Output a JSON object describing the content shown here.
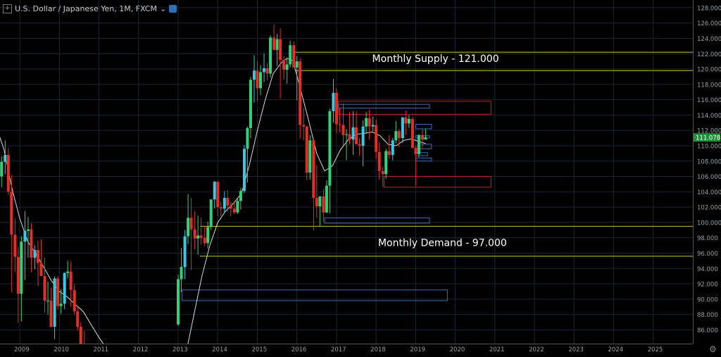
{
  "header": {
    "symbol": "U.S. Dollar / Japanese Yen, 1M, FXCM",
    "expand_icon": "plus-square-icon",
    "visibility_icon": "eye-icon"
  },
  "settings_icon": "gear-icon",
  "chart_data": {
    "type": "candlestick",
    "timeframe": "1M",
    "x_ticks": [
      "2009",
      "2010",
      "2011",
      "2012",
      "2013",
      "2014",
      "2015",
      "2016",
      "2017",
      "2018",
      "2019",
      "2020",
      "2021",
      "2022",
      "2023",
      "2024",
      "2025"
    ],
    "y_ticks": [
      86,
      88,
      90,
      92,
      94,
      96,
      98,
      100,
      102,
      104,
      106,
      108,
      110,
      112,
      114,
      116,
      118,
      120,
      122,
      124,
      126,
      128
    ],
    "y_tick_labels": [
      "86.000",
      "88.000",
      "90.000",
      "92.000",
      "94.000",
      "96.000",
      "98.000",
      "100.000",
      "102.000",
      "104.000",
      "106.000",
      "108.000",
      "110.000",
      "112.000",
      "114.000",
      "116.000",
      "118.000",
      "120.000",
      "122.000",
      "124.000",
      "126.000",
      "128.000"
    ],
    "ylim": [
      84.2,
      129.0
    ],
    "xlim": [
      2008.5,
      2026.0
    ],
    "grid": true,
    "last_price": 111.078,
    "last_price_label": "111.078",
    "colors": {
      "background": "#000000",
      "grid": "#1a2530",
      "axis_text": "#9aa0a6",
      "bull": "#33d17a",
      "bull_alt": "#3ec7e0",
      "bear": "#e0302a",
      "moving_average": "#d9d9d9",
      "supply_line": "#c9c23a",
      "demand_line": "#c9c23a",
      "zone_red": "#cc2020",
      "zone_blue": "#3b6fb6",
      "price_tag": "#1e8f3a"
    },
    "candles": [
      {
        "t": 2008.38,
        "o": 101.5,
        "h": 104.8,
        "l": 100.5,
        "c": 103.6
      },
      {
        "t": 2008.46,
        "o": 103.6,
        "h": 108.4,
        "l": 102.6,
        "c": 106.0
      },
      {
        "t": 2008.54,
        "o": 106.0,
        "h": 108.6,
        "l": 104.6,
        "c": 107.9
      },
      {
        "t": 2008.63,
        "o": 107.9,
        "h": 110.7,
        "l": 106.3,
        "c": 108.8
      },
      {
        "t": 2008.71,
        "o": 108.8,
        "h": 109.7,
        "l": 103.6,
        "c": 104.0
      },
      {
        "t": 2008.79,
        "o": 104.0,
        "h": 106.2,
        "l": 90.9,
        "c": 98.4
      },
      {
        "t": 2008.88,
        "o": 98.4,
        "h": 100.5,
        "l": 93.5,
        "c": 95.5
      },
      {
        "t": 2008.96,
        "o": 95.5,
        "h": 96.8,
        "l": 86.9,
        "c": 90.7
      },
      {
        "t": 2009.04,
        "o": 90.7,
        "h": 98.2,
        "l": 87.1,
        "c": 97.5
      },
      {
        "t": 2009.13,
        "o": 97.5,
        "h": 101.5,
        "l": 92.5,
        "c": 98.9
      },
      {
        "t": 2009.21,
        "o": 98.9,
        "h": 100.7,
        "l": 95.4,
        "c": 99.1
      },
      {
        "t": 2009.29,
        "o": 99.1,
        "h": 99.9,
        "l": 93.5,
        "c": 95.4
      },
      {
        "t": 2009.38,
        "o": 95.4,
        "h": 97.0,
        "l": 93.9,
        "c": 96.4
      },
      {
        "t": 2009.46,
        "o": 96.4,
        "h": 97.6,
        "l": 91.7,
        "c": 94.7
      },
      {
        "t": 2009.54,
        "o": 94.7,
        "h": 97.8,
        "l": 93.0,
        "c": 93.0
      },
      {
        "t": 2009.63,
        "o": 93.0,
        "h": 95.4,
        "l": 88.2,
        "c": 89.8
      },
      {
        "t": 2009.71,
        "o": 89.8,
        "h": 92.3,
        "l": 88.0,
        "c": 89.8
      },
      {
        "t": 2009.79,
        "o": 89.8,
        "h": 91.5,
        "l": 86.3,
        "c": 86.4
      },
      {
        "t": 2009.88,
        "o": 86.4,
        "h": 93.0,
        "l": 84.8,
        "c": 92.7
      },
      {
        "t": 2009.96,
        "o": 92.7,
        "h": 93.0,
        "l": 88.6,
        "c": 89.1
      },
      {
        "t": 2010.04,
        "o": 89.1,
        "h": 91.3,
        "l": 88.1,
        "c": 89.4
      },
      {
        "t": 2010.13,
        "o": 89.4,
        "h": 93.5,
        "l": 88.7,
        "c": 93.4
      },
      {
        "t": 2010.21,
        "o": 93.4,
        "h": 95.0,
        "l": 92.7,
        "c": 93.6
      },
      {
        "t": 2010.29,
        "o": 93.6,
        "h": 94.9,
        "l": 89.0,
        "c": 91.2
      },
      {
        "t": 2010.38,
        "o": 91.2,
        "h": 92.0,
        "l": 88.0,
        "c": 88.4
      },
      {
        "t": 2010.46,
        "o": 88.4,
        "h": 89.0,
        "l": 85.9,
        "c": 86.4
      },
      {
        "t": 2010.54,
        "o": 86.4,
        "h": 87.0,
        "l": 83.6,
        "c": 84.1
      },
      {
        "t": 2010.63,
        "o": 84.1,
        "h": 85.9,
        "l": 81.4,
        "c": 83.3
      },
      {
        "t": 2013.0,
        "o": 86.7,
        "h": 93.2,
        "l": 86.5,
        "c": 92.6
      },
      {
        "t": 2013.08,
        "o": 92.6,
        "h": 96.7,
        "l": 90.9,
        "c": 94.2
      },
      {
        "t": 2013.17,
        "o": 94.2,
        "h": 99.0,
        "l": 92.6,
        "c": 98.2
      },
      {
        "t": 2013.25,
        "o": 98.2,
        "h": 103.7,
        "l": 97.2,
        "c": 100.6
      },
      {
        "t": 2013.33,
        "o": 100.6,
        "h": 103.2,
        "l": 93.8,
        "c": 99.1
      },
      {
        "t": 2013.42,
        "o": 99.1,
        "h": 101.5,
        "l": 96.5,
        "c": 97.9
      },
      {
        "t": 2013.5,
        "o": 97.9,
        "h": 100.9,
        "l": 95.8,
        "c": 98.3
      },
      {
        "t": 2013.58,
        "o": 98.3,
        "h": 100.6,
        "l": 97.1,
        "c": 98.0
      },
      {
        "t": 2013.67,
        "o": 98.0,
        "h": 99.6,
        "l": 96.9,
        "c": 97.3
      },
      {
        "t": 2013.75,
        "o": 97.3,
        "h": 100.1,
        "l": 96.6,
        "c": 99.4
      },
      {
        "t": 2013.83,
        "o": 99.4,
        "h": 103.0,
        "l": 99.0,
        "c": 103.0
      },
      {
        "t": 2013.92,
        "o": 103.0,
        "h": 105.4,
        "l": 101.8,
        "c": 105.3
      },
      {
        "t": 2014.0,
        "o": 105.3,
        "h": 105.4,
        "l": 100.8,
        "c": 102.0
      },
      {
        "t": 2014.08,
        "o": 102.0,
        "h": 102.7,
        "l": 100.8,
        "c": 101.8
      },
      {
        "t": 2014.17,
        "o": 101.8,
        "h": 104.1,
        "l": 101.2,
        "c": 103.2
      },
      {
        "t": 2014.25,
        "o": 103.2,
        "h": 104.2,
        "l": 101.4,
        "c": 102.2
      },
      {
        "t": 2014.33,
        "o": 102.2,
        "h": 102.7,
        "l": 100.8,
        "c": 101.8
      },
      {
        "t": 2014.42,
        "o": 101.8,
        "h": 102.8,
        "l": 101.1,
        "c": 101.3
      },
      {
        "t": 2014.5,
        "o": 101.3,
        "h": 103.1,
        "l": 101.1,
        "c": 102.8
      },
      {
        "t": 2014.58,
        "o": 102.8,
        "h": 104.5,
        "l": 101.7,
        "c": 104.1
      },
      {
        "t": 2014.67,
        "o": 104.1,
        "h": 110.1,
        "l": 103.8,
        "c": 109.6
      },
      {
        "t": 2014.75,
        "o": 109.6,
        "h": 112.5,
        "l": 105.2,
        "c": 112.3
      },
      {
        "t": 2014.83,
        "o": 112.3,
        "h": 119.0,
        "l": 111.0,
        "c": 118.6
      },
      {
        "t": 2014.92,
        "o": 118.6,
        "h": 121.8,
        "l": 115.6,
        "c": 119.8
      },
      {
        "t": 2015.0,
        "o": 119.8,
        "h": 121.0,
        "l": 115.8,
        "c": 117.5
      },
      {
        "t": 2015.08,
        "o": 117.5,
        "h": 120.5,
        "l": 116.6,
        "c": 119.6
      },
      {
        "t": 2015.17,
        "o": 119.6,
        "h": 122.0,
        "l": 118.3,
        "c": 120.1
      },
      {
        "t": 2015.25,
        "o": 120.1,
        "h": 120.8,
        "l": 118.5,
        "c": 119.4
      },
      {
        "t": 2015.33,
        "o": 119.4,
        "h": 124.4,
        "l": 118.9,
        "c": 124.1
      },
      {
        "t": 2015.42,
        "o": 124.1,
        "h": 125.8,
        "l": 122.4,
        "c": 122.5
      },
      {
        "t": 2015.5,
        "o": 122.5,
        "h": 124.6,
        "l": 120.4,
        "c": 123.9
      },
      {
        "t": 2015.58,
        "o": 123.9,
        "h": 125.3,
        "l": 116.1,
        "c": 121.2
      },
      {
        "t": 2015.67,
        "o": 121.2,
        "h": 121.7,
        "l": 118.6,
        "c": 119.9
      },
      {
        "t": 2015.75,
        "o": 119.9,
        "h": 121.5,
        "l": 118.1,
        "c": 120.6
      },
      {
        "t": 2015.83,
        "o": 120.6,
        "h": 123.7,
        "l": 120.2,
        "c": 123.1
      },
      {
        "t": 2015.92,
        "o": 123.1,
        "h": 123.6,
        "l": 120.2,
        "c": 120.2
      },
      {
        "t": 2016.0,
        "o": 120.2,
        "h": 121.7,
        "l": 115.9,
        "c": 121.0
      },
      {
        "t": 2016.08,
        "o": 121.0,
        "h": 121.4,
        "l": 110.9,
        "c": 112.7
      },
      {
        "t": 2016.17,
        "o": 112.7,
        "h": 114.9,
        "l": 110.7,
        "c": 112.5
      },
      {
        "t": 2016.25,
        "o": 112.5,
        "h": 112.6,
        "l": 105.5,
        "c": 106.5
      },
      {
        "t": 2016.33,
        "o": 106.5,
        "h": 111.4,
        "l": 105.6,
        "c": 110.7
      },
      {
        "t": 2016.42,
        "o": 110.7,
        "h": 110.9,
        "l": 99.0,
        "c": 103.2
      },
      {
        "t": 2016.5,
        "o": 103.2,
        "h": 107.5,
        "l": 100.6,
        "c": 102.1
      },
      {
        "t": 2016.58,
        "o": 102.1,
        "h": 103.3,
        "l": 99.5,
        "c": 103.4
      },
      {
        "t": 2016.67,
        "o": 103.4,
        "h": 104.3,
        "l": 100.1,
        "c": 101.3
      },
      {
        "t": 2016.75,
        "o": 101.3,
        "h": 105.5,
        "l": 101.2,
        "c": 104.8
      },
      {
        "t": 2016.83,
        "o": 104.8,
        "h": 114.8,
        "l": 101.2,
        "c": 114.5
      },
      {
        "t": 2016.92,
        "o": 114.5,
        "h": 118.7,
        "l": 113.0,
        "c": 116.9
      },
      {
        "t": 2017.0,
        "o": 116.9,
        "h": 117.5,
        "l": 111.6,
        "c": 112.8
      },
      {
        "t": 2017.08,
        "o": 112.8,
        "h": 114.9,
        "l": 111.7,
        "c": 112.7
      },
      {
        "t": 2017.17,
        "o": 112.7,
        "h": 115.5,
        "l": 110.1,
        "c": 111.4
      },
      {
        "t": 2017.25,
        "o": 111.4,
        "h": 112.2,
        "l": 108.1,
        "c": 111.5
      },
      {
        "t": 2017.33,
        "o": 111.5,
        "h": 114.4,
        "l": 110.2,
        "c": 110.8
      },
      {
        "t": 2017.42,
        "o": 110.8,
        "h": 114.5,
        "l": 108.8,
        "c": 112.4
      },
      {
        "t": 2017.5,
        "o": 112.4,
        "h": 114.5,
        "l": 110.6,
        "c": 110.2
      },
      {
        "t": 2017.58,
        "o": 110.2,
        "h": 111.0,
        "l": 108.7,
        "c": 110.0
      },
      {
        "t": 2017.67,
        "o": 110.0,
        "h": 113.3,
        "l": 107.3,
        "c": 112.5
      },
      {
        "t": 2017.75,
        "o": 112.5,
        "h": 114.4,
        "l": 111.7,
        "c": 113.6
      },
      {
        "t": 2017.83,
        "o": 113.6,
        "h": 114.7,
        "l": 110.8,
        "c": 112.5
      },
      {
        "t": 2017.92,
        "o": 112.5,
        "h": 113.8,
        "l": 111.9,
        "c": 112.7
      },
      {
        "t": 2018.0,
        "o": 112.7,
        "h": 113.4,
        "l": 108.3,
        "c": 109.2
      },
      {
        "t": 2018.08,
        "o": 109.2,
        "h": 110.5,
        "l": 105.6,
        "c": 106.7
      },
      {
        "t": 2018.17,
        "o": 106.7,
        "h": 107.3,
        "l": 104.6,
        "c": 106.3
      },
      {
        "t": 2018.25,
        "o": 106.3,
        "h": 109.6,
        "l": 105.7,
        "c": 109.3
      },
      {
        "t": 2018.33,
        "o": 109.3,
        "h": 111.4,
        "l": 108.3,
        "c": 108.8
      },
      {
        "t": 2018.42,
        "o": 108.8,
        "h": 111.0,
        "l": 108.1,
        "c": 110.7
      },
      {
        "t": 2018.5,
        "o": 110.7,
        "h": 113.2,
        "l": 110.3,
        "c": 111.9
      },
      {
        "t": 2018.58,
        "o": 111.9,
        "h": 112.2,
        "l": 109.8,
        "c": 111.0
      },
      {
        "t": 2018.67,
        "o": 111.0,
        "h": 113.7,
        "l": 110.4,
        "c": 113.7
      },
      {
        "t": 2018.75,
        "o": 113.7,
        "h": 114.6,
        "l": 111.4,
        "c": 112.9
      },
      {
        "t": 2018.83,
        "o": 112.9,
        "h": 114.0,
        "l": 112.3,
        "c": 113.5
      },
      {
        "t": 2018.92,
        "o": 113.5,
        "h": 113.8,
        "l": 110.3,
        "c": 109.7
      },
      {
        "t": 2019.0,
        "o": 109.7,
        "h": 110.0,
        "l": 104.8,
        "c": 108.9
      },
      {
        "t": 2019.08,
        "o": 108.9,
        "h": 111.5,
        "l": 108.5,
        "c": 111.4
      },
      {
        "t": 2019.17,
        "o": 111.4,
        "h": 112.1,
        "l": 109.7,
        "c": 110.8
      },
      {
        "t": 2019.25,
        "o": 110.8,
        "h": 112.2,
        "l": 110.8,
        "c": 111.1
      }
    ],
    "moving_average": [
      [
        2008.4,
        112.6
      ],
      [
        2008.6,
        109.5
      ],
      [
        2008.8,
        104.5
      ],
      [
        2009.0,
        100.5
      ],
      [
        2009.2,
        97.5
      ],
      [
        2009.4,
        96.0
      ],
      [
        2009.6,
        94.2
      ],
      [
        2009.8,
        92.4
      ],
      [
        2010.0,
        91.0
      ],
      [
        2010.2,
        90.3
      ],
      [
        2010.4,
        89.3
      ],
      [
        2010.6,
        88.4
      ],
      [
        2010.8,
        86.7
      ],
      [
        2011.0,
        85.0
      ],
      [
        2011.2,
        83.5
      ],
      [
        2011.4,
        82.0
      ],
      [
        2013.2,
        83.0
      ],
      [
        2013.4,
        88.0
      ],
      [
        2013.6,
        93.0
      ],
      [
        2013.8,
        97.0
      ],
      [
        2014.0,
        100.0
      ],
      [
        2014.2,
        101.5
      ],
      [
        2014.4,
        102.5
      ],
      [
        2014.6,
        103.8
      ],
      [
        2014.8,
        107.5
      ],
      [
        2015.0,
        112.0
      ],
      [
        2015.2,
        116.0
      ],
      [
        2015.4,
        119.4
      ],
      [
        2015.6,
        120.8
      ],
      [
        2015.75,
        121.4
      ],
      [
        2015.9,
        121.1
      ],
      [
        2016.1,
        117.2
      ],
      [
        2016.3,
        113.2
      ],
      [
        2016.5,
        109.0
      ],
      [
        2016.7,
        106.7
      ],
      [
        2016.9,
        107.4
      ],
      [
        2017.1,
        109.5
      ],
      [
        2017.3,
        110.8
      ],
      [
        2017.5,
        111.5
      ],
      [
        2017.7,
        111.6
      ],
      [
        2017.9,
        111.8
      ],
      [
        2018.1,
        111.3
      ],
      [
        2018.3,
        110.2
      ],
      [
        2018.5,
        110.0
      ],
      [
        2018.7,
        110.7
      ],
      [
        2018.9,
        110.9
      ],
      [
        2019.1,
        110.5
      ],
      [
        2019.25,
        110.3
      ]
    ],
    "horizontal_lines": [
      {
        "y": 122.2,
        "x_start": 2015.95
      },
      {
        "y": 119.8,
        "x_start": 2015.95
      },
      {
        "y": 99.5,
        "x_start": 2013.55
      },
      {
        "y": 95.6,
        "x_start": 2013.55
      }
    ],
    "zones": [
      {
        "color": "red",
        "y1": 114.1,
        "y2": 115.8,
        "x1": 2017.05,
        "x2": 2020.9
      },
      {
        "color": "blue",
        "y1": 114.9,
        "y2": 115.4,
        "x1": 2017.05,
        "x2": 2019.35
      },
      {
        "color": "blue",
        "y1": 112.2,
        "y2": 112.8,
        "x1": 2019.0,
        "x2": 2019.4
      },
      {
        "color": "blue",
        "y1": 111.0,
        "y2": 111.3,
        "x1": 2019.0,
        "x2": 2019.35
      },
      {
        "color": "blue",
        "y1": 109.6,
        "y2": 110.2,
        "x1": 2019.05,
        "x2": 2019.4
      },
      {
        "color": "blue",
        "y1": 108.7,
        "y2": 109.1,
        "x1": 2019.0,
        "x2": 2019.3
      },
      {
        "color": "blue",
        "y1": 108.0,
        "y2": 108.4,
        "x1": 2019.0,
        "x2": 2019.4
      },
      {
        "color": "red",
        "y1": 104.6,
        "y2": 106.0,
        "x1": 2018.2,
        "x2": 2020.9
      },
      {
        "color": "blue",
        "y1": 99.9,
        "y2": 100.6,
        "x1": 2016.7,
        "x2": 2019.35
      },
      {
        "color": "blue",
        "y1": 89.8,
        "y2": 91.2,
        "x1": 2013.1,
        "x2": 2019.8
      }
    ],
    "annotations": [
      {
        "text": "Monthly Supply - 121.000",
        "x": 2017.9,
        "y": 120.9
      },
      {
        "text": "Monthly Demand - 97.000",
        "x": 2018.05,
        "y": 96.9
      }
    ]
  }
}
